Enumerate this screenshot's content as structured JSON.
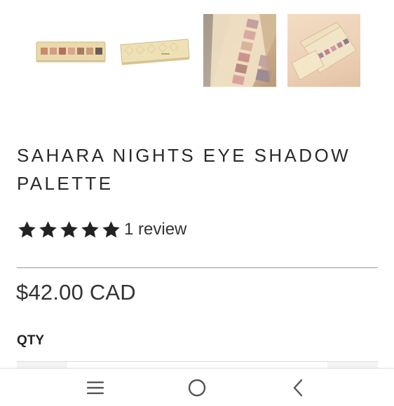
{
  "gallery": {
    "thumbnails": [
      {
        "icon": "palette-open-photo"
      },
      {
        "icon": "palette-closed-photo"
      },
      {
        "icon": "palette-closeup-photo"
      },
      {
        "icon": "palette-angled-photo"
      }
    ]
  },
  "product": {
    "title": "SAHARA NIGHTS EYE SHADOW PALETTE",
    "rating": 5,
    "review_text": "1 review",
    "price": "$42.00 CAD"
  },
  "quantity": {
    "label": "QTY"
  },
  "navbar": {
    "items": [
      {
        "icon": "menu-icon"
      },
      {
        "icon": "home-circle-icon"
      },
      {
        "icon": "back-chevron-icon"
      }
    ]
  },
  "colors": {
    "text": "#2a2a2a",
    "star": "#222222",
    "divider": "#9a9a9a",
    "gold": "#e9d7a5"
  }
}
